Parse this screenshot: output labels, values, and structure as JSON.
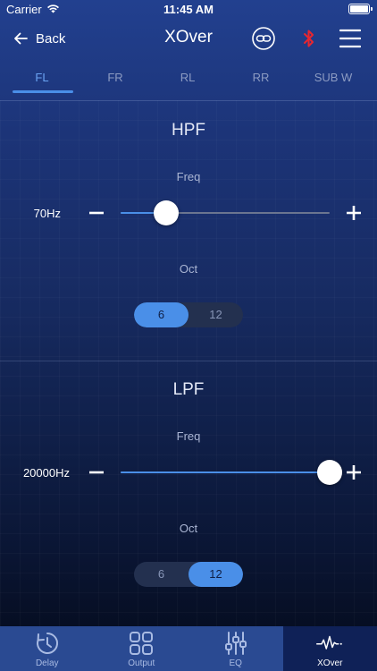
{
  "status": {
    "carrier": "Carrier",
    "time": "11:45 AM"
  },
  "nav": {
    "back_label": "Back",
    "title": "XOver"
  },
  "tabs": [
    {
      "label": "FL",
      "active": true
    },
    {
      "label": "FR",
      "active": false
    },
    {
      "label": "RL",
      "active": false
    },
    {
      "label": "RR",
      "active": false
    },
    {
      "label": "SUB W",
      "active": false
    }
  ],
  "hpf": {
    "title": "HPF",
    "freq_label": "Freq",
    "freq_value": "70Hz",
    "slider_fraction": 0.22,
    "oct_label": "Oct",
    "oct_options": [
      "6",
      "12"
    ],
    "oct_selected": "6"
  },
  "lpf": {
    "title": "LPF",
    "freq_label": "Freq",
    "freq_value": "20000Hz",
    "slider_fraction": 1.0,
    "oct_label": "Oct",
    "oct_options": [
      "6",
      "12"
    ],
    "oct_selected": "12"
  },
  "tabbar": [
    {
      "label": "Delay",
      "icon": "clock-icon"
    },
    {
      "label": "Output",
      "icon": "grid-icon"
    },
    {
      "label": "EQ",
      "icon": "sliders-icon"
    },
    {
      "label": "XOver",
      "icon": "waveform-icon",
      "active": true
    }
  ],
  "colors": {
    "accent": "#4a8fe8",
    "bluetooth": "#e8262f",
    "tabbar_bg": "#2a4a92",
    "tabbar_active": "#0f2157"
  }
}
